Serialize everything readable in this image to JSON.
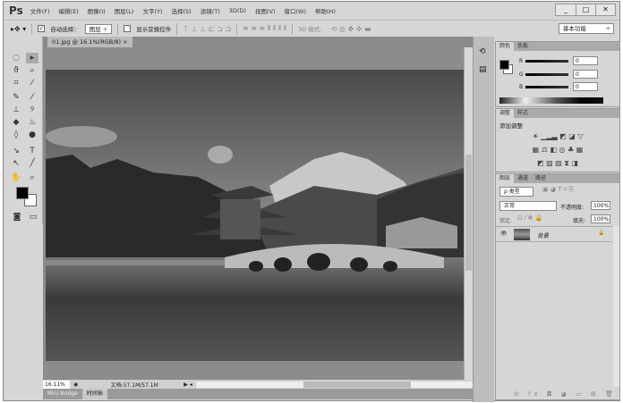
{
  "app": {
    "logo": "Ps",
    "menus": [
      "文件(F)",
      "编辑(E)",
      "图像(I)",
      "图层(L)",
      "文字(Y)",
      "选择(S)",
      "滤镜(T)",
      "3D(D)",
      "视图(V)",
      "窗口(W)",
      "帮助(H)"
    ],
    "window_buttons": [
      "_",
      "□",
      "✕"
    ]
  },
  "options": {
    "auto_select_label": "自动选择：",
    "auto_select_checked": "✓",
    "auto_select_value": "图层",
    "show_transform_label": "显示变换控件",
    "mode_3d_label": "3D 模式：",
    "workspace": "基本功能"
  },
  "document": {
    "tab_title": "01.jpg @ 16.1%(RGB/8)",
    "close": "×",
    "zoom": "16.11%",
    "doc_info": "文档:57.1M/57.1M"
  },
  "bottom_tabs": [
    "Mini Bridge",
    "时间轴"
  ],
  "color_panel": {
    "tabs": [
      "颜色",
      "色板"
    ],
    "channels": [
      {
        "label": "R",
        "value": "0"
      },
      {
        "label": "G",
        "value": "0"
      },
      {
        "label": "B",
        "value": "0"
      }
    ]
  },
  "adjust_panel": {
    "tabs": [
      "调整",
      "样式"
    ],
    "title": "添加调整"
  },
  "layers_panel": {
    "tabs": [
      "图层",
      "通道",
      "路径"
    ],
    "filter": "ρ 类型",
    "blend_mode": "正常",
    "opacity_label": "不透明度:",
    "opacity": "100%",
    "lock_label": "锁定:",
    "fill_label": "填充:",
    "fill": "100%",
    "layers": [
      {
        "name": "背景",
        "visible": "👁",
        "lock": "🔒"
      }
    ]
  }
}
